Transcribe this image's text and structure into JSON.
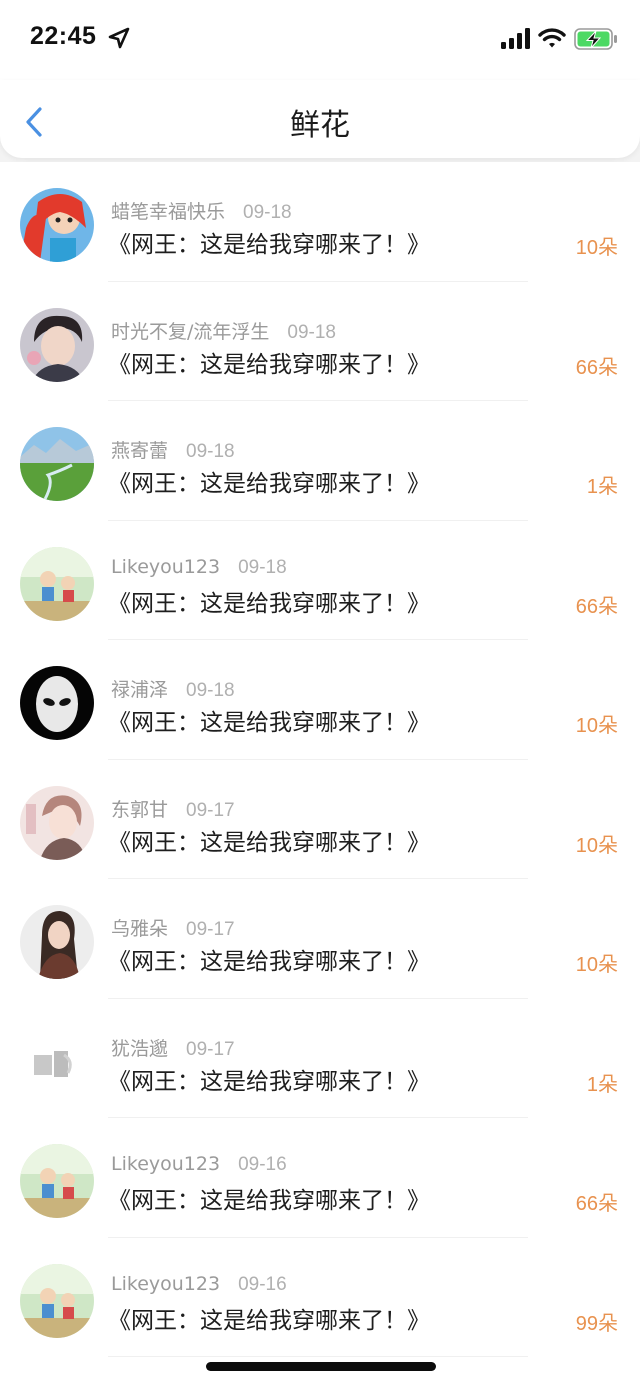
{
  "status_bar": {
    "time": "22:45",
    "icons": [
      "location-arrow-icon",
      "cellular-signal-icon",
      "wifi-icon",
      "battery-charging-icon"
    ]
  },
  "nav": {
    "back_icon": "chevron-left-icon",
    "title": "鲜花"
  },
  "colors": {
    "accent": "#4a90e2",
    "count": "#e8924f",
    "battery": "#4cd964"
  },
  "rows": [
    {
      "name": "蜡笔幸福快乐",
      "date": "09-18",
      "title": "《网王：这是给我穿哪来了！》",
      "count": "10朵"
    },
    {
      "name": "时光不复/流年浮生",
      "date": "09-18",
      "title": "《网王：这是给我穿哪来了！》",
      "count": "66朵"
    },
    {
      "name": "燕寄蕾",
      "date": "09-18",
      "title": "《网王：这是给我穿哪来了！》",
      "count": "1朵"
    },
    {
      "name": "Likeyou123",
      "date": "09-18",
      "title": "《网王：这是给我穿哪来了！》",
      "count": "66朵"
    },
    {
      "name": "禄浦泽",
      "date": "09-18",
      "title": "《网王：这是给我穿哪来了！》",
      "count": "10朵"
    },
    {
      "name": "东郭甘",
      "date": "09-17",
      "title": "《网王：这是给我穿哪来了！》",
      "count": "10朵"
    },
    {
      "name": "乌雅朵",
      "date": "09-17",
      "title": "《网王：这是给我穿哪来了！》",
      "count": "10朵"
    },
    {
      "name": "犹浩邈",
      "date": "09-17",
      "title": "《网王：这是给我穿哪来了！》",
      "count": "1朵"
    },
    {
      "name": "Likeyou123",
      "date": "09-16",
      "title": "《网王：这是给我穿哪来了！》",
      "count": "66朵"
    },
    {
      "name": "Likeyou123",
      "date": "09-16",
      "title": "《网王：这是给我穿哪来了！》",
      "count": "99朵"
    }
  ]
}
